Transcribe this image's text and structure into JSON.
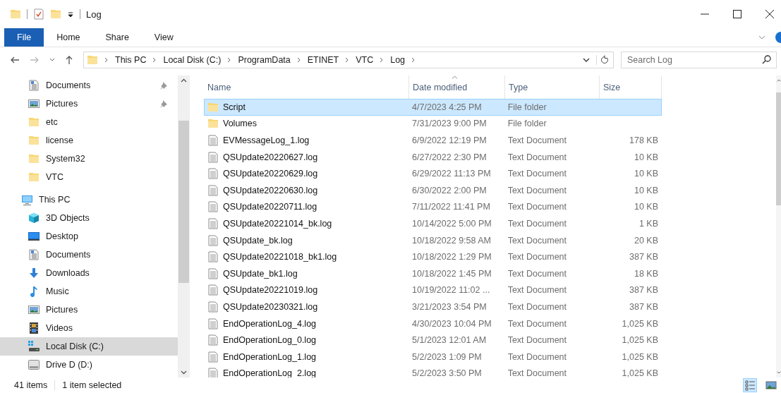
{
  "window": {
    "title": "Log"
  },
  "ribbon": {
    "tabs": [
      {
        "label": "File",
        "kind": "file",
        "selected": false
      },
      {
        "label": "Home",
        "kind": "tab",
        "selected": false
      },
      {
        "label": "Share",
        "kind": "tab",
        "selected": false
      },
      {
        "label": "View",
        "kind": "tab",
        "selected": false
      }
    ]
  },
  "address": {
    "crumbs": [
      "This PC",
      "Local Disk (C:)",
      "ProgramData",
      "ETINET",
      "VTC",
      "Log"
    ]
  },
  "search": {
    "placeholder": "Search Log"
  },
  "sidebar": {
    "quick_items": [
      {
        "label": "Documents",
        "kind": "documents",
        "pinned": true,
        "selected": false
      },
      {
        "label": "Pictures",
        "kind": "pictures",
        "pinned": true,
        "selected": false
      },
      {
        "label": "etc",
        "kind": "folder",
        "pinned": false,
        "selected": false
      },
      {
        "label": "license",
        "kind": "folder",
        "pinned": false,
        "selected": false
      },
      {
        "label": "System32",
        "kind": "folder",
        "pinned": false,
        "selected": false
      },
      {
        "label": "VTC",
        "kind": "folder",
        "pinned": false,
        "selected": false
      }
    ],
    "tree": [
      {
        "label": "This PC",
        "kind": "pc",
        "selected": false,
        "children": [
          {
            "label": "3D Objects",
            "kind": "objects",
            "selected": false
          },
          {
            "label": "Desktop",
            "kind": "desktop",
            "selected": false
          },
          {
            "label": "Documents",
            "kind": "documents",
            "selected": false
          },
          {
            "label": "Downloads",
            "kind": "downloads",
            "selected": false
          },
          {
            "label": "Music",
            "kind": "music",
            "selected": false
          },
          {
            "label": "Pictures",
            "kind": "pictures",
            "selected": false
          },
          {
            "label": "Videos",
            "kind": "videos",
            "selected": false
          },
          {
            "label": "Local Disk (C:)",
            "kind": "disk",
            "selected": true
          },
          {
            "label": "Drive D (D:)",
            "kind": "drive",
            "selected": false
          }
        ]
      }
    ]
  },
  "file_list": {
    "columns": [
      {
        "label": "Name",
        "sorted": false
      },
      {
        "label": "Date modified",
        "sorted": true
      },
      {
        "label": "Type",
        "sorted": false
      },
      {
        "label": "Size",
        "sorted": false
      }
    ],
    "rows": [
      {
        "name": "Script",
        "kind": "folder",
        "date": "4/7/2023 4:25 PM",
        "type": "File folder",
        "selected": true
      },
      {
        "name": "Volumes",
        "kind": "folder",
        "date": "7/31/2023 9:00 PM",
        "type": "File folder",
        "selected": false
      },
      {
        "name": "EVMessageLog_1.log",
        "kind": "text",
        "date": "6/9/2022 12:19 PM",
        "type": "Text Document",
        "size": "178 KB",
        "selected": false
      },
      {
        "name": "QSUpdate20220627.log",
        "kind": "text",
        "date": "6/27/2022 2:30 PM",
        "type": "Text Document",
        "size": "10 KB",
        "selected": false
      },
      {
        "name": "QSUpdate20220629.log",
        "kind": "text",
        "date": "6/29/2022 11:13 PM",
        "type": "Text Document",
        "size": "10 KB",
        "selected": false
      },
      {
        "name": "QSUpdate20220630.log",
        "kind": "text",
        "date": "6/30/2022 2:00 PM",
        "type": "Text Document",
        "size": "10 KB",
        "selected": false
      },
      {
        "name": "QSUpdate20220711.log",
        "kind": "text",
        "date": "7/11/2022 11:41 PM",
        "type": "Text Document",
        "size": "10 KB",
        "selected": false
      },
      {
        "name": "QSUpdate20221014_bk.log",
        "kind": "text",
        "date": "10/14/2022 5:00 PM",
        "type": "Text Document",
        "size": "1 KB",
        "selected": false
      },
      {
        "name": "QSUpdate_bk.log",
        "kind": "text",
        "date": "10/18/2022 9:58 AM",
        "type": "Text Document",
        "size": "20 KB",
        "selected": false
      },
      {
        "name": "QSUpdate20221018_bk1.log",
        "kind": "text",
        "date": "10/18/2022 1:29 PM",
        "type": "Text Document",
        "size": "387 KB",
        "selected": false
      },
      {
        "name": "QSUpdate_bk1.log",
        "kind": "text",
        "date": "10/18/2022 1:45 PM",
        "type": "Text Document",
        "size": "18 KB",
        "selected": false
      },
      {
        "name": "QSUpdate20221019.log",
        "kind": "text",
        "date": "10/19/2022 11:02 ...",
        "type": "Text Document",
        "size": "387 KB",
        "selected": false
      },
      {
        "name": "QSUpdate20230321.log",
        "kind": "text",
        "date": "3/21/2023 3:54 PM",
        "type": "Text Document",
        "size": "387 KB",
        "selected": false
      },
      {
        "name": "EndOperationLog_4.log",
        "kind": "text",
        "date": "4/30/2023 10:04 PM",
        "type": "Text Document",
        "size": "1,025 KB",
        "selected": false
      },
      {
        "name": "EndOperationLog_0.log",
        "kind": "text",
        "date": "5/1/2023 12:01 AM",
        "type": "Text Document",
        "size": "1,025 KB",
        "selected": false
      },
      {
        "name": "EndOperationLog_1.log",
        "kind": "text",
        "date": "5/2/2023 1:09 PM",
        "type": "Text Document",
        "size": "1,025 KB",
        "selected": false
      },
      {
        "name": "EndOperationLog_2.log",
        "kind": "text",
        "date": "5/2/2023 3:50 PM",
        "type": "Text Document",
        "size": "1,025 KB",
        "selected": false
      }
    ]
  },
  "status_bar": {
    "item_count": "41 items",
    "selection": "1 item selected"
  },
  "view_buttons": [
    {
      "kind": "details",
      "selected": true
    },
    {
      "kind": "large",
      "selected": false
    }
  ]
}
